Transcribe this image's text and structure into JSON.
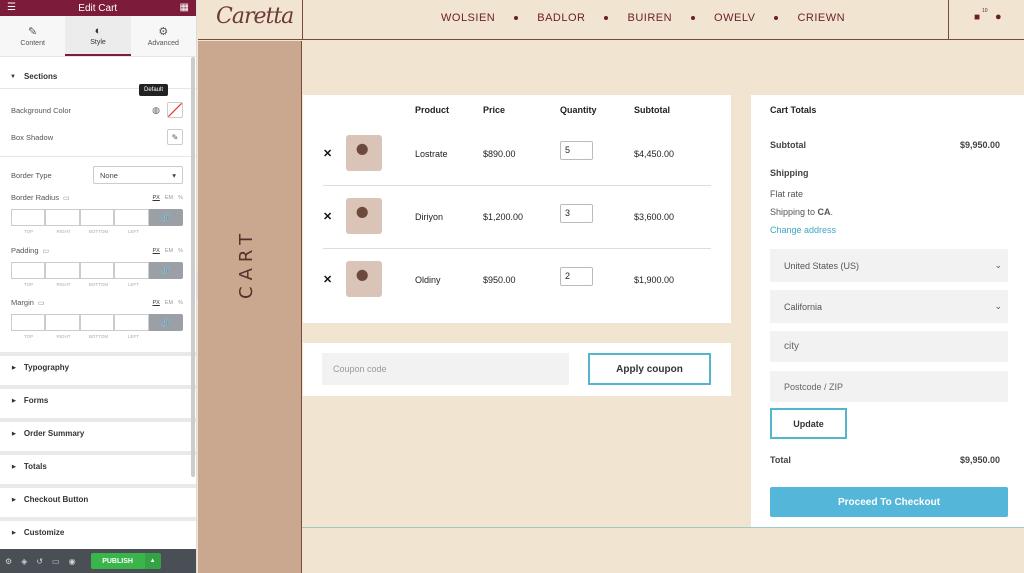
{
  "panel": {
    "title": "Edit Cart",
    "tabs": [
      {
        "label": "Content"
      },
      {
        "label": "Style"
      },
      {
        "label": "Advanced"
      }
    ],
    "sections_label": "Sections",
    "tooltip": "Default",
    "background_color_label": "Background Color",
    "box_shadow_label": "Box Shadow",
    "border_type_label": "Border Type",
    "border_type_value": "None",
    "border_radius_label": "Border Radius",
    "padding_label": "Padding",
    "margin_label": "Margin",
    "units": [
      "PX",
      "EM",
      "%"
    ],
    "dim_labels": [
      "TOP",
      "RIGHT",
      "BOTTOM",
      "LEFT"
    ],
    "collapsed_sections": [
      "Typography",
      "Forms",
      "Order Summary",
      "Totals",
      "Checkout Button",
      "Customize"
    ],
    "publish_label": "PUBLISH"
  },
  "site": {
    "logo": "Caretta",
    "nav": [
      "WOLSIEN",
      "BADLOR",
      "BUIREN",
      "OWELV",
      "CRIEWN"
    ],
    "cart_count": "10",
    "page_label": "CART"
  },
  "cart": {
    "headers": {
      "product": "Product",
      "price": "Price",
      "quantity": "Quantity",
      "subtotal": "Subtotal"
    },
    "items": [
      {
        "name": "Lostrate",
        "price": "$890.00",
        "qty": "5",
        "subtotal": "$4,450.00"
      },
      {
        "name": "Diriyon",
        "price": "$1,200.00",
        "qty": "3",
        "subtotal": "$3,600.00"
      },
      {
        "name": "Oldiny",
        "price": "$950.00",
        "qty": "2",
        "subtotal": "$1,900.00"
      }
    ],
    "coupon_placeholder": "Coupon code",
    "apply_label": "Apply coupon"
  },
  "totals": {
    "title": "Cart Totals",
    "subtotal_label": "Subtotal",
    "subtotal_value": "$9,950.00",
    "shipping_label": "Shipping",
    "flat_rate": "Flat rate",
    "shipping_to_prefix": "Shipping to ",
    "shipping_to_state": "CA",
    "shipping_to_suffix": ".",
    "change_address": "Change address",
    "country": "United States (US)",
    "state": "California",
    "city_placeholder": "city",
    "zip_placeholder": "Postcode / ZIP",
    "update_label": "Update",
    "total_label": "Total",
    "total_value": "$9,950.00",
    "checkout_label": "Proceed To Checkout"
  }
}
